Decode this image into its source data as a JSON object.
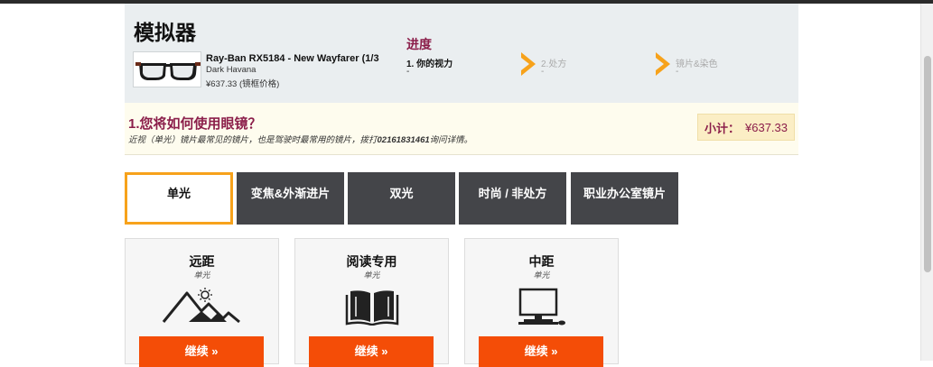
{
  "header": {
    "title": "模拟器",
    "product": {
      "name": "Ray-Ban RX5184 - New Wayfarer (1/3",
      "color": "Dark Havana",
      "price": "¥637.33 (镜框价格)"
    },
    "progress": {
      "title": "进度",
      "steps": [
        {
          "label": "1. 你的视力",
          "sub": "-"
        },
        {
          "label": "2.处方",
          "sub": "-"
        },
        {
          "label": "镜片&染色",
          "sub": "-"
        }
      ]
    }
  },
  "question": {
    "title": "1.您将如何使用眼镜？",
    "desc_prefix": "近视（单光）镜片最常见的镜片，也是驾驶时最常用的镜片，拨打",
    "desc_phone": "02161831461",
    "desc_suffix": "询问详情。",
    "subtotal_label": "小计：",
    "subtotal_value": "¥637.33"
  },
  "tabs": [
    {
      "label": "单光",
      "active": true
    },
    {
      "label": "变焦&外渐进片",
      "active": false
    },
    {
      "label": "双光",
      "active": false
    },
    {
      "label": "时尚 / 非处方",
      "active": false
    },
    {
      "label": "职业办公室镜片",
      "active": false
    }
  ],
  "cards": [
    {
      "title": "远距",
      "sub": "单光",
      "icon": "mountain-sun-icon",
      "button": "继续 »"
    },
    {
      "title": "阅读专用",
      "sub": "单光",
      "icon": "open-book-icon",
      "button": "继续 »"
    },
    {
      "title": "中距",
      "sub": "单光",
      "icon": "desktop-computer-icon",
      "button": "继续 »"
    }
  ],
  "colors": {
    "accent": "#f7a21b",
    "brand": "#8b1e4a",
    "button": "#f44d07",
    "tab_dark": "#444549"
  }
}
